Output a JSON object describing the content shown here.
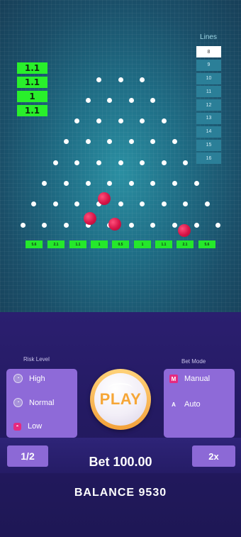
{
  "history": [
    "1.1",
    "1.1",
    "1",
    "1.1"
  ],
  "lines": {
    "title": "Lines",
    "options": [
      "8",
      "9",
      "10",
      "11",
      "12",
      "13",
      "14",
      "15",
      "16"
    ]
  },
  "slots": [
    "5.6",
    "2.1",
    "1.1",
    "1",
    "0.5",
    "1",
    "1.1",
    "2.1",
    "5.6"
  ],
  "risk": {
    "title": "Risk Level",
    "options": [
      "High",
      "Normal",
      "Low"
    ],
    "selected": "Low"
  },
  "bet_mode": {
    "title": "Bet Mode",
    "options": [
      "Manual",
      "Auto"
    ],
    "selected": "Manual",
    "icons": [
      "M",
      "A"
    ]
  },
  "play_label": "PLAY",
  "half_label": "1/2",
  "double_label": "2x",
  "bet_text": "Bet 100.00",
  "balance_text": "BALANCE 9530",
  "colors": {
    "accent_green": "#29ef2b",
    "panel_purple": "#8e6ad8",
    "play_orange": "#f6a637",
    "ball_red": "#d61447",
    "icon_pink": "#e62a80"
  }
}
